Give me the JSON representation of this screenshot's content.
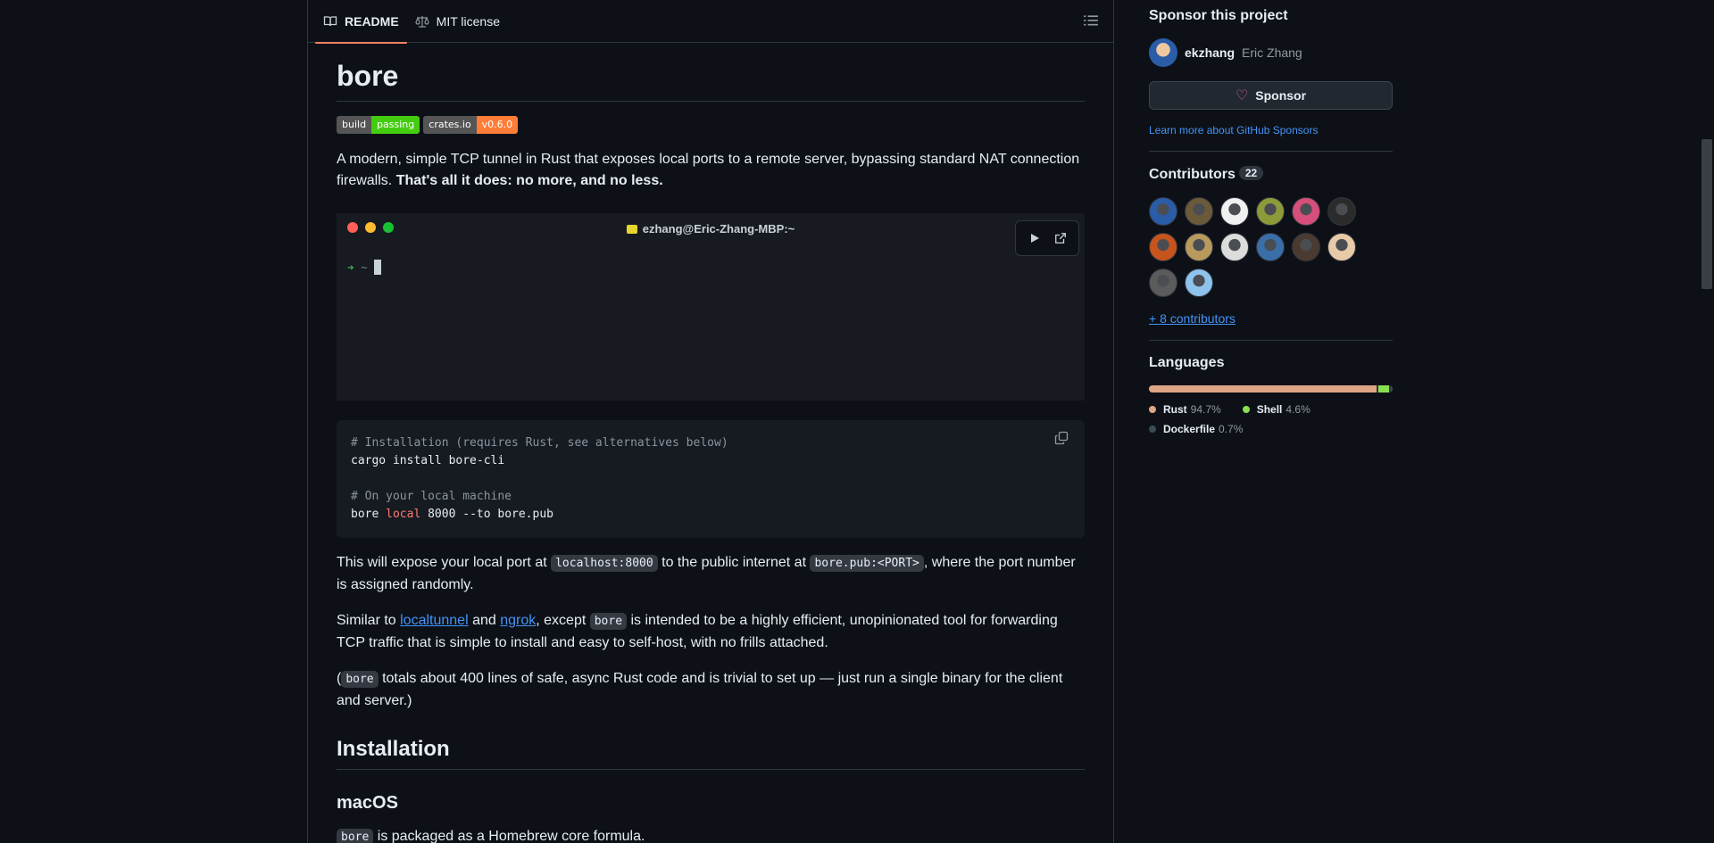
{
  "tabs": [
    {
      "label": "README",
      "icon": "book-icon",
      "active": true
    },
    {
      "label": "MIT license",
      "icon": "scale-icon",
      "active": false
    }
  ],
  "readme": {
    "title": "bore",
    "badges": [
      {
        "label": "build",
        "value": "passing",
        "color": "#4c1"
      },
      {
        "label": "crates.io",
        "value": "v0.6.0",
        "color": "#fe7d37"
      }
    ],
    "intro": "A modern, simple TCP tunnel in Rust that exposes local ports to a remote server, bypassing standard NAT connection firewalls. ",
    "intro_bold": "That's all it does: no more, and no less.",
    "terminal": {
      "title": "ezhang@Eric-Zhang-MBP:~",
      "prompt_arrow": "➜",
      "prompt_dir": "~",
      "dot_colors": [
        "#ff5f58",
        "#ffbd2e",
        "#18c132"
      ]
    },
    "code": {
      "line1": "# Installation (requires Rust, see alternatives below)",
      "line2": "cargo install bore-cli",
      "line3": "# On your local machine",
      "line4_a": "bore ",
      "line4_kw": "local",
      "line4_b": " 8000 --to bore.pub"
    },
    "p1_a": "This will expose your local port at ",
    "p1_code1": "localhost:8000",
    "p1_b": " to the public internet at ",
    "p1_code2": "bore.pub:<PORT>",
    "p1_c": ", where the port number is assigned randomly.",
    "p2_a": "Similar to ",
    "p2_link1": "localtunnel",
    "p2_b": " and ",
    "p2_link2": "ngrok",
    "p2_c": ", except ",
    "p2_code": "bore",
    "p2_d": " is intended to be a highly efficient, unopinionated tool for forwarding TCP traffic that is simple to install and easy to self-host, with no frills attached.",
    "p3_a": "(",
    "p3_code": "bore",
    "p3_b": " totals about 400 lines of safe, async Rust code and is trivial to set up — just run a single binary for the client and server.)",
    "h2_install": "Installation",
    "h3_macos": "macOS",
    "p4_code": "bore",
    "p4_b": " is packaged as a Homebrew core formula."
  },
  "sidebar": {
    "sponsor_heading": "Sponsor this project",
    "sponsor_login": "ekzhang",
    "sponsor_name": "Eric Zhang",
    "sponsor_button": "Sponsor",
    "sponsor_learn": "Learn more about GitHub Sponsors",
    "contributors_heading": "Contributors",
    "contributors_count": "22",
    "contributor_avatar_colors": [
      "#2a5ca8",
      "#6b5a3a",
      "#f0f0f0",
      "#8c9a3a",
      "#d64f7a",
      "#2b2b2b",
      "#c6541c",
      "#b89a5e",
      "#dcdcdc",
      "#3a6ea8",
      "#4a3a30",
      "#e8c9a8",
      "#5b5b5b",
      "#8ec3ee"
    ],
    "more_contributors": "+ 8 contributors",
    "languages_heading": "Languages",
    "languages": [
      {
        "name": "Rust",
        "pct": "94.7%",
        "value": 94.7,
        "color": "#dea584"
      },
      {
        "name": "Shell",
        "pct": "4.6%",
        "value": 4.6,
        "color": "#89e051"
      },
      {
        "name": "Dockerfile",
        "pct": "0.7%",
        "value": 0.7,
        "color": "#384d54"
      }
    ]
  }
}
